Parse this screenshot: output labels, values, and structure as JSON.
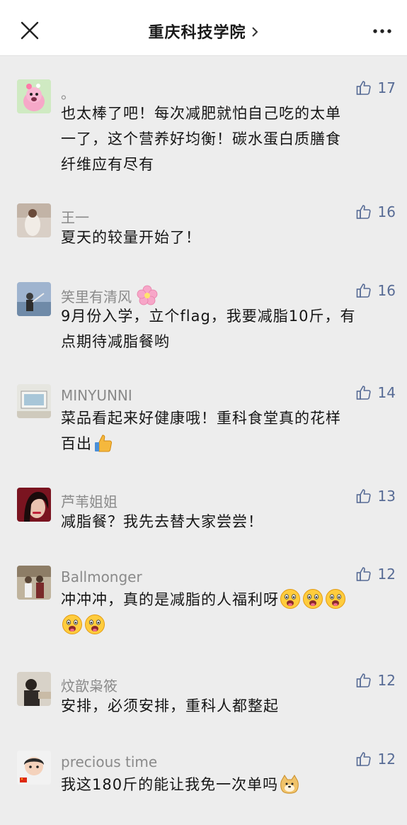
{
  "header": {
    "title": "重庆科技学院",
    "close_icon": "close-icon",
    "chevron_icon": "chevron-right-icon",
    "more_icon": "more-dots-icon"
  },
  "colors": {
    "link_blue": "#576b95",
    "name_gray": "#8a8a8a",
    "background": "#ededed"
  },
  "comments": [
    {
      "name": "。",
      "likes": "17",
      "lines": [
        "也太棒了吧！每次减肥就怕自己吃的太单",
        "一了，这个营养好均衡！碳水蛋白质膳食",
        "纤维应有尽有"
      ]
    },
    {
      "name": "王一",
      "likes": "16",
      "lines": [
        "夏天的较量开始了！"
      ]
    },
    {
      "name": "笑里有清风",
      "name_emoji": "cherry-blossom",
      "likes": "16",
      "lines": [
        "9月份入学，立个flag，我要减脂10斤，有",
        "点期待减脂餐哟"
      ]
    },
    {
      "name": "MINYUNNI",
      "likes": "14",
      "lines": [
        "菜品看起来好健康哦！重科食堂真的花样",
        "百出"
      ],
      "line_emoji": "thumbs-up"
    },
    {
      "name": "芦苇姐姐",
      "likes": "13",
      "lines": [
        "减脂餐？我先去替大家尝尝！"
      ]
    },
    {
      "name": "Ballmonger",
      "likes": "12",
      "lines": [
        "冲冲冲，真的是减脂的人福利呀"
      ],
      "line_emoji": "drooling-face"
    },
    {
      "name": "炆歆枭筱",
      "likes": "12",
      "lines": [
        "安排，必须安排，重科人都整起"
      ]
    },
    {
      "name": "precious time",
      "likes": "12",
      "lines": [
        "我这180斤的能让我免一次单吗"
      ],
      "line_emoji": "doge"
    }
  ]
}
